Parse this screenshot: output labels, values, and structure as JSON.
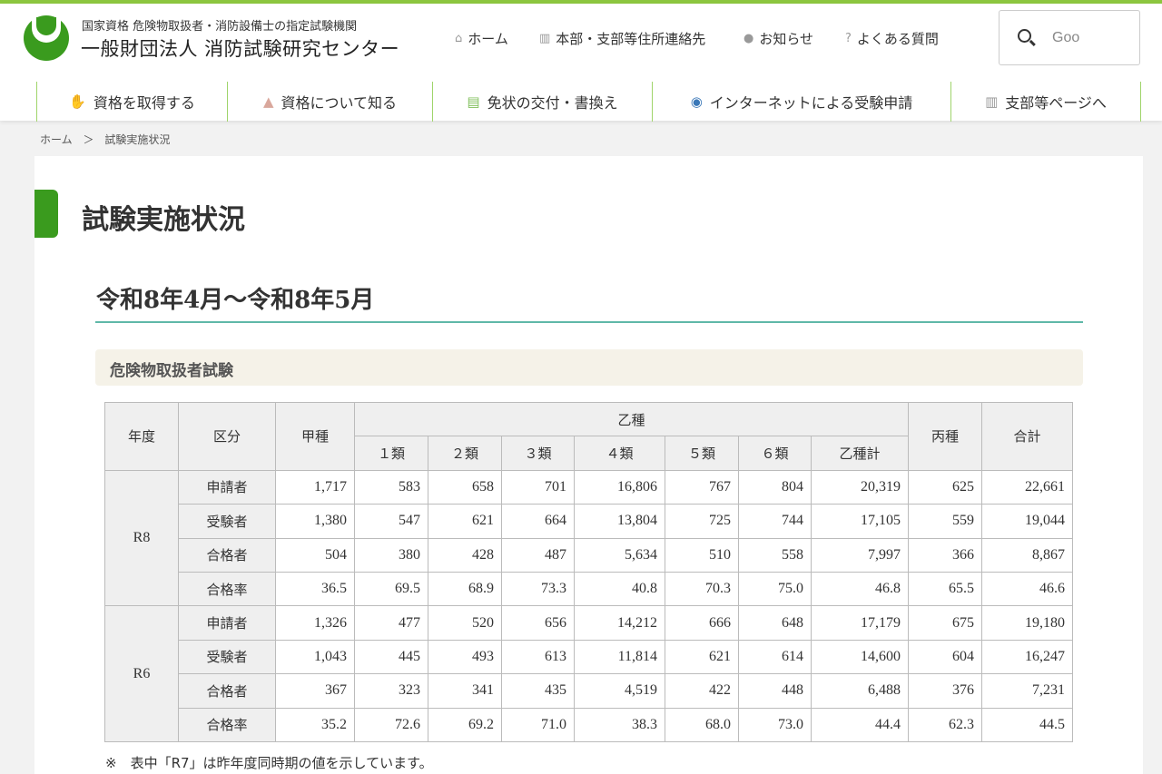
{
  "header": {
    "org_sub": "国家資格 危険物取扱者・消防設備士の指定試験機関",
    "org_main": "一般財団法人 消防試験研究センター",
    "util_links": [
      {
        "label": "ホーム",
        "icon": "home-icon"
      },
      {
        "label": "本部・支部等住所連絡先",
        "icon": "map-icon"
      },
      {
        "label": "お知らせ",
        "icon": "info-icon"
      },
      {
        "label": "よくある質問",
        "icon": "question-icon"
      }
    ],
    "search_value": "Goo"
  },
  "gnav": [
    {
      "label": "資格を取得する",
      "icon": "hand-icon"
    },
    {
      "label": "資格について知る",
      "icon": "people-icon"
    },
    {
      "label": "免状の交付・書換え",
      "icon": "id-card-icon"
    },
    {
      "label": "インターネットによる受験申請",
      "icon": "globe-doc-icon"
    },
    {
      "label": "支部等ページへ",
      "icon": "map-icon"
    }
  ],
  "breadcrumb": [
    "ホーム",
    "＞",
    "試験実施状況"
  ],
  "page_title": "試験実施状況",
  "period": "令和8年4月～令和8年5月",
  "section_title": "危険物取扱者試験",
  "table": {
    "headers": {
      "year": "年度",
      "kubun": "区分",
      "kou": "甲種",
      "otsu": "乙種",
      "otsu_sub": [
        "１類",
        "２類",
        "３類",
        "４類",
        "５類",
        "６類",
        "乙種計"
      ],
      "hei": "丙種",
      "total": "合計"
    },
    "groups": [
      {
        "year": "R8",
        "rows": [
          {
            "kubun": "申請者",
            "values": [
              "1,717",
              "583",
              "658",
              "701",
              "16,806",
              "767",
              "804",
              "20,319",
              "625",
              "22,661"
            ]
          },
          {
            "kubun": "受験者",
            "values": [
              "1,380",
              "547",
              "621",
              "664",
              "13,804",
              "725",
              "744",
              "17,105",
              "559",
              "19,044"
            ]
          },
          {
            "kubun": "合格者",
            "values": [
              "504",
              "380",
              "428",
              "487",
              "5,634",
              "510",
              "558",
              "7,997",
              "366",
              "8,867"
            ]
          },
          {
            "kubun": "合格率",
            "values": [
              "36.5",
              "69.5",
              "68.9",
              "73.3",
              "40.8",
              "70.3",
              "75.0",
              "46.8",
              "65.5",
              "46.6"
            ]
          }
        ]
      },
      {
        "year": "R6",
        "rows": [
          {
            "kubun": "申請者",
            "values": [
              "1,326",
              "477",
              "520",
              "656",
              "14,212",
              "666",
              "648",
              "17,179",
              "675",
              "19,180"
            ]
          },
          {
            "kubun": "受験者",
            "values": [
              "1,043",
              "445",
              "493",
              "613",
              "11,814",
              "621",
              "614",
              "14,600",
              "604",
              "16,247"
            ]
          },
          {
            "kubun": "合格者",
            "values": [
              "367",
              "323",
              "341",
              "435",
              "4,519",
              "422",
              "448",
              "6,488",
              "376",
              "7,231"
            ]
          },
          {
            "kubun": "合格率",
            "values": [
              "35.2",
              "72.6",
              "69.2",
              "71.0",
              "38.3",
              "68.0",
              "73.0",
              "44.4",
              "62.3",
              "44.5"
            ]
          }
        ]
      }
    ]
  },
  "note": "※　表中「R7」は昨年度同時期の値を示しています。",
  "colors": {
    "accent_green": "#3a9b1e",
    "topbar": "#8cc63f",
    "nav_border": "#9fd46a",
    "rule_teal": "#5fb8a8",
    "section_bg": "#f5f2e8"
  }
}
